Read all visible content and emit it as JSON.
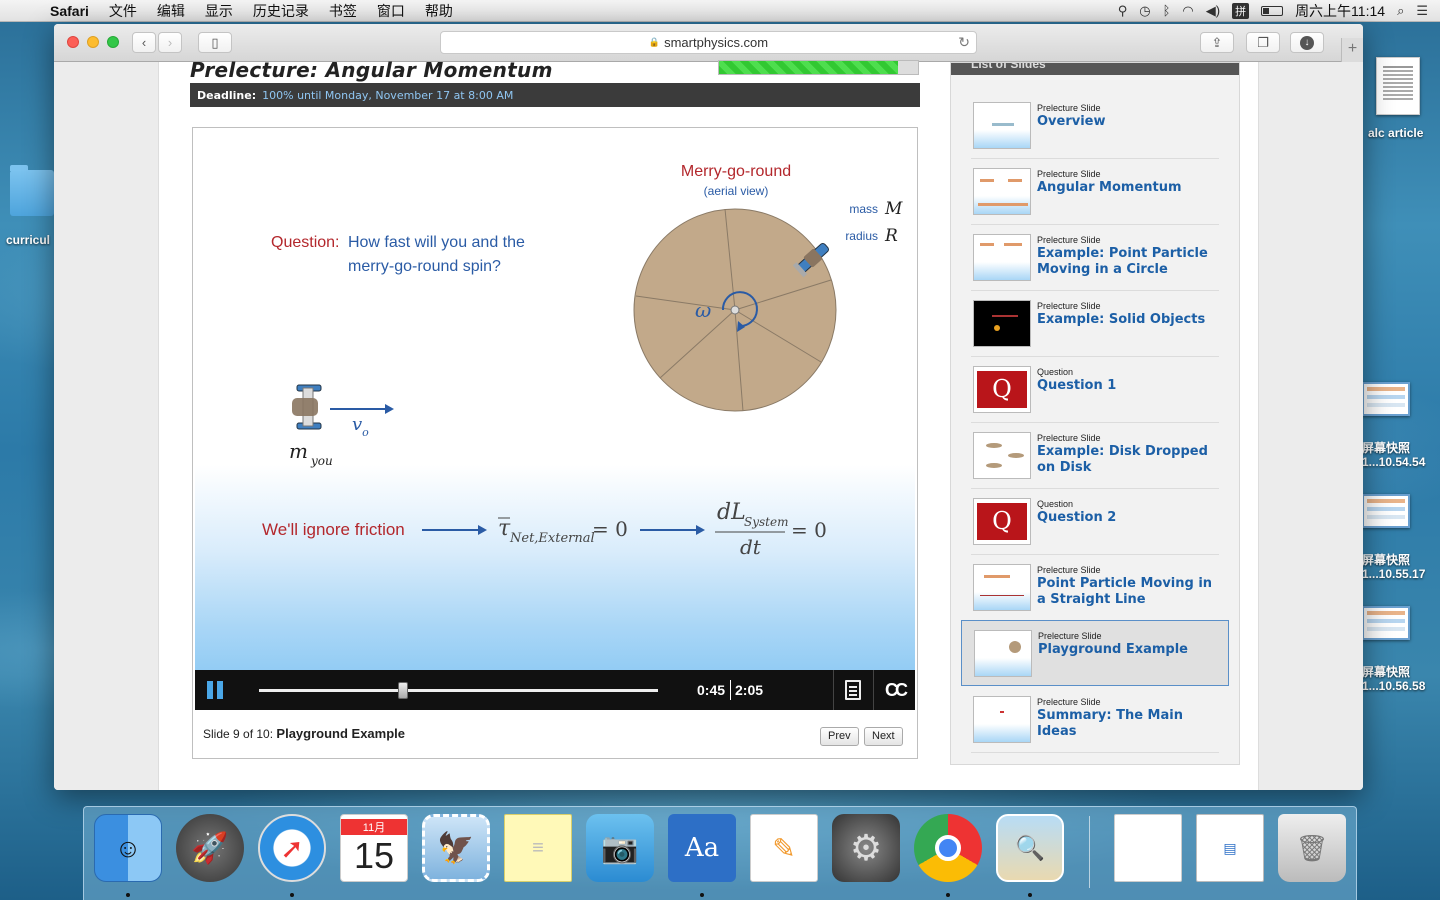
{
  "menubar": {
    "app": "Safari",
    "items": [
      "文件",
      "编辑",
      "显示",
      "历史记录",
      "书签",
      "窗口",
      "帮助"
    ],
    "ime": "拼",
    "clock": "周六上午11:14"
  },
  "browser": {
    "url": "smartphysics.com"
  },
  "page": {
    "title": "Prelecture: Angular Momentum",
    "progress_fraction": 0.9,
    "deadline_label": "Deadline:",
    "deadline_value": "100% until Monday, November 17 at 8:00 AM"
  },
  "slide": {
    "mgr_title": "Merry-go-round",
    "mgr_subtitle": "(aerial view)",
    "mass_label": "mass",
    "mass_symbol": "M",
    "radius_label": "radius",
    "radius_symbol": "R",
    "omega": "ω",
    "question_label": "Question:",
    "question_line1": "How fast will you and the",
    "question_line2": "merry-go-round spin?",
    "velocity_symbol": "v",
    "velocity_sub": "o",
    "mass_you": "m",
    "mass_you_sub": "you",
    "friction_text": "We'll ignore friction",
    "tau": "τ",
    "tau_sub": "Net,External",
    "eq_zero": "= 0",
    "dL": "dL",
    "dL_sub": "System",
    "dt": "dt"
  },
  "player": {
    "current_time": "0:45",
    "total_time": "2:05",
    "progress_fraction": 0.36,
    "cc_label": "CC"
  },
  "footer": {
    "slide_position": "Slide 9 of 10:",
    "slide_name": "Playground Example",
    "prev": "Prev",
    "next": "Next"
  },
  "slides_panel": {
    "header": "List of Slides",
    "items": [
      {
        "kind": "Prelecture Slide",
        "title": "Overview",
        "thumb": "plain"
      },
      {
        "kind": "Prelecture Slide",
        "title": "Angular Momentum",
        "thumb": "diagram"
      },
      {
        "kind": "Prelecture Slide",
        "title": "Example: Point Particle Moving in a Circle",
        "thumb": "diagram"
      },
      {
        "kind": "Prelecture Slide",
        "title": "Example: Solid Objects",
        "thumb": "dark"
      },
      {
        "kind": "Question",
        "title": "Question 1",
        "thumb": "question"
      },
      {
        "kind": "Prelecture Slide",
        "title": "Example: Disk Dropped on Disk",
        "thumb": "disks"
      },
      {
        "kind": "Question",
        "title": "Question 2",
        "thumb": "question"
      },
      {
        "kind": "Prelecture Slide",
        "title": "Point Particle Moving in a Straight Line",
        "thumb": "diagram"
      },
      {
        "kind": "Prelecture Slide",
        "title": "Playground Example",
        "thumb": "playground",
        "active": true
      },
      {
        "kind": "Prelecture Slide",
        "title": "Summary: The Main Ideas",
        "thumb": "plain"
      }
    ]
  },
  "desktop": {
    "folder_label": "curricul",
    "doc_label": "alc article",
    "shots": [
      {
        "line1": "屏幕快照",
        "line2": "1...10.54.54"
      },
      {
        "line1": "屏幕快照",
        "line2": "1...10.55.17"
      },
      {
        "line1": "屏幕快照",
        "line2": "1...10.56.58"
      }
    ]
  },
  "dock": {
    "calendar_month": "11月",
    "calendar_day": "15"
  }
}
